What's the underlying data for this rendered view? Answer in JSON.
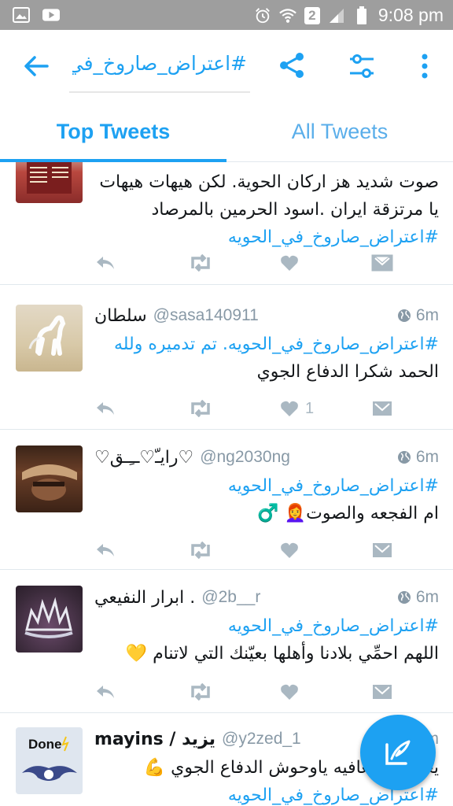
{
  "status_bar": {
    "time": "9:08 pm",
    "sim_number": "2"
  },
  "header": {
    "search_query": "#اعتراض_صاروخ_في_ا"
  },
  "tabs": [
    {
      "label": "Top Tweets",
      "active": true
    },
    {
      "label": "All Tweets",
      "active": false
    }
  ],
  "tweets": [
    {
      "name": "",
      "handle": "",
      "time": "",
      "body_lines": [
        "صوت شديد هز اركان الحوية. لكن هيهات هيهات",
        "يا مرتزقة ايران .اسود الحرمين بالمرصاد"
      ],
      "hashtag": "#اعتراض_صاروخ_في_الحويه",
      "likes": ""
    },
    {
      "name": "سلطان",
      "handle": "@sasa140911",
      "time": "6m",
      "hashtag": "#اعتراض_صاروخ_في_الحويه. تم تدميره ولله",
      "body_lines": [
        "الحمد شكرا الدفاع الجوي"
      ],
      "likes": "1"
    },
    {
      "name": "♡رايـّ♡ــِـق♡",
      "handle": "@ng2030ng",
      "time": "6m",
      "hashtag": "#اعتراض_صاروخ_في_الحويه",
      "body_lines": [
        "ام الفجعه والصوت👩‍🦰 ♂️"
      ],
      "likes": ""
    },
    {
      "name": "ابرار النفيعي .",
      "handle": "@2b__r",
      "time": "6m",
      "hashtag": "#اعتراض_صاروخ_في_الحويه",
      "body_lines": [
        "اللهم احمِّي بلادنا وأهلها بعيّنك التي لاتنام 💛"
      ],
      "likes": ""
    },
    {
      "name": "mayins / يزيد",
      "handle": "@y2zed_1",
      "time": "6m",
      "body_lines": [
        "يعطيكم العافيه ياوحوش الدفاع الجوي 💪"
      ],
      "hashtag": "#اعتراض_صاروخ_في_الحويه",
      "avatar_text": "Done",
      "likes": ""
    }
  ],
  "colors": {
    "accent": "#1da1f2",
    "status_bar": "#9e9e9e",
    "action_gray": "#aab8c2",
    "meta_gray": "#8899a6"
  },
  "icons": [
    "image-icon",
    "youtube-icon",
    "alarm-icon",
    "wifi-icon",
    "signal-icon",
    "battery-icon",
    "back-arrow-icon",
    "share-icon",
    "filter-icon",
    "more-vert-icon",
    "globe-icon",
    "reply-icon",
    "retweet-icon",
    "heart-icon",
    "message-icon",
    "compose-icon"
  ]
}
